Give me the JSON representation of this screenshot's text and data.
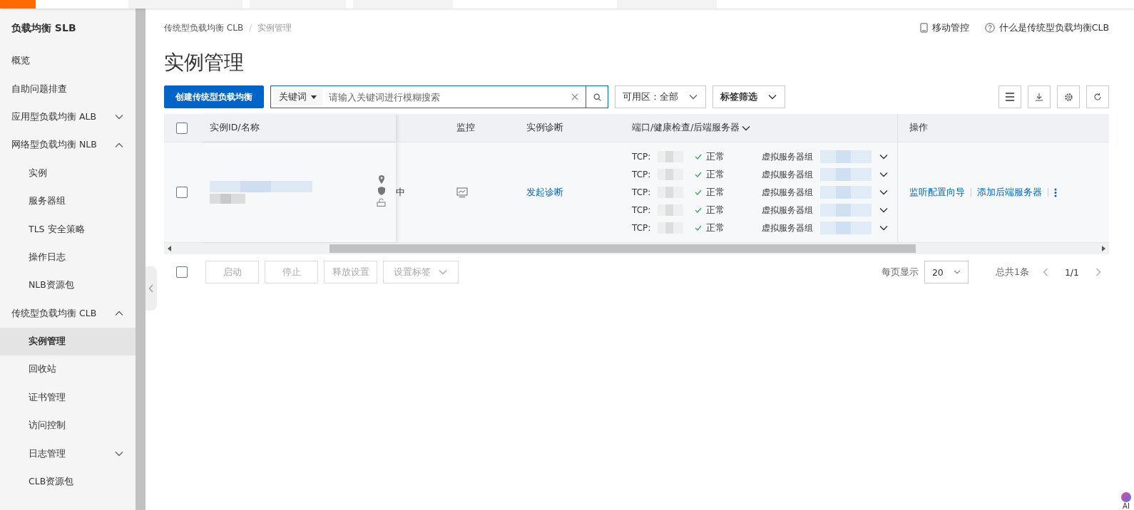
{
  "sidebar": {
    "title": "负载均衡 SLB",
    "items": [
      {
        "label": "概览",
        "selected": false
      },
      {
        "label": "自助问题排查",
        "selected": false
      },
      {
        "label": "应用型负载均衡 ALB",
        "selected": false,
        "expanded": false
      },
      {
        "label": "网络型负载均衡 NLB",
        "selected": false,
        "expanded": true,
        "children": [
          {
            "label": "实例",
            "selected": false
          },
          {
            "label": "服务器组",
            "selected": false
          },
          {
            "label": "TLS 安全策略",
            "selected": false
          },
          {
            "label": "操作日志",
            "selected": false
          },
          {
            "label": "NLB资源包",
            "selected": false
          }
        ]
      },
      {
        "label": "传统型负载均衡 CLB",
        "selected": false,
        "expanded": true,
        "children": [
          {
            "label": "实例管理",
            "selected": true
          },
          {
            "label": "回收站",
            "selected": false
          },
          {
            "label": "证书管理",
            "selected": false
          },
          {
            "label": "访问控制",
            "selected": false
          },
          {
            "label": "日志管理",
            "selected": false,
            "expanded": false
          },
          {
            "label": "CLB资源包",
            "selected": false
          }
        ]
      }
    ]
  },
  "breadcrumb": [
    "传统型负载均衡 CLB",
    "实例管理"
  ],
  "breadcrumb_separator": "/",
  "header_links": [
    {
      "kind": "app",
      "label": "移动管控"
    },
    {
      "kind": "help",
      "label": "什么是传统型负载均衡CLB"
    }
  ],
  "page_title": "实例管理",
  "toolbar": {
    "create_button": "创建传统型负载均衡",
    "search_type": "关键词",
    "search": {
      "placeholder": "请输入关键词进行模糊搜索"
    },
    "zone_filter": "可用区：全部",
    "tag_filter": "标签筛选"
  },
  "table": {
    "columns": {
      "id_name": "实例ID/名称",
      "monitor": "监控",
      "diagnosis": "实例诊断",
      "listeners": "端口/健康检查/后端服务器",
      "actions": "操作"
    },
    "select_all": {
      "checked": false
    },
    "rows": [
      {
        "checked": false,
        "status_fragment": "中",
        "diagnose_link": "发起诊断",
        "listeners": [
          {
            "protocol": "TCP:",
            "health": "正常",
            "group": "虚拟服务器组"
          },
          {
            "protocol": "TCP:",
            "health": "正常",
            "group": "虚拟服务器组"
          },
          {
            "protocol": "TCP:",
            "health": "正常",
            "group": "虚拟服务器组"
          },
          {
            "protocol": "TCP:",
            "health": "正常",
            "group": "虚拟服务器组"
          },
          {
            "protocol": "TCP:",
            "health": "正常",
            "group": "虚拟服务器组"
          }
        ],
        "actions": [
          "监听配置向导",
          "添加后端服务器"
        ]
      }
    ]
  },
  "footer": {
    "select_all": {
      "checked": false
    },
    "buttons": [
      {
        "label": "启动",
        "disabled": true,
        "kind": "plain"
      },
      {
        "label": "停止",
        "disabled": true,
        "kind": "plain"
      },
      {
        "label": "释放设置",
        "disabled": true,
        "kind": "plain"
      },
      {
        "label": "设置标签",
        "disabled": true,
        "kind": "dropdown"
      }
    ],
    "page_size_label": "每页显示",
    "page_size": "20",
    "total": "总共1条",
    "page": "1/1"
  },
  "ai_badge": "AI"
}
